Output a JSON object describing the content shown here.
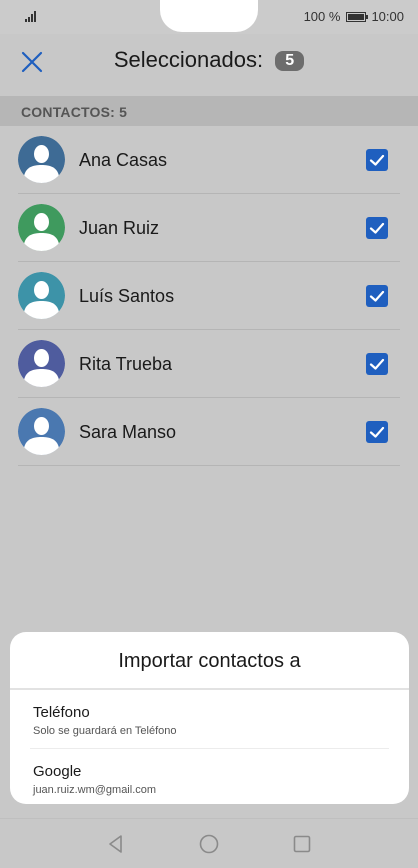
{
  "status_bar": {
    "battery_text": "100 %",
    "time": "10:00"
  },
  "header": {
    "title": "Seleccionados:",
    "selected_count": "5"
  },
  "section": {
    "label": "CONTACTOS: 5"
  },
  "contacts": [
    {
      "name": "Ana Casas",
      "checked": true,
      "avatar_color": "#3e6b95"
    },
    {
      "name": "Juan Ruiz",
      "checked": true,
      "avatar_color": "#3f9a5e"
    },
    {
      "name": "Luís Santos",
      "checked": true,
      "avatar_color": "#3d93a8"
    },
    {
      "name": "Rita Trueba",
      "checked": true,
      "avatar_color": "#4f5c9e"
    },
    {
      "name": "Sara Manso",
      "checked": true,
      "avatar_color": "#4a78b0"
    }
  ],
  "sheet": {
    "title": "Importar contactos a",
    "options": [
      {
        "title": "Teléfono",
        "subtitle": "Solo se guardará en Teléfono"
      },
      {
        "title": "Google",
        "subtitle": "juan.ruiz.wm@gmail.com"
      }
    ]
  },
  "colors": {
    "accent": "#1f5fbf",
    "background": "#c8c8c8",
    "sheet": "#ffffff"
  },
  "icons": {
    "close": "close-icon",
    "checkbox": "checkbox-checked-icon",
    "avatar": "person-avatar-icon",
    "nav_back": "back-triangle-icon",
    "nav_home": "home-circle-icon",
    "nav_recent": "recent-square-icon"
  }
}
